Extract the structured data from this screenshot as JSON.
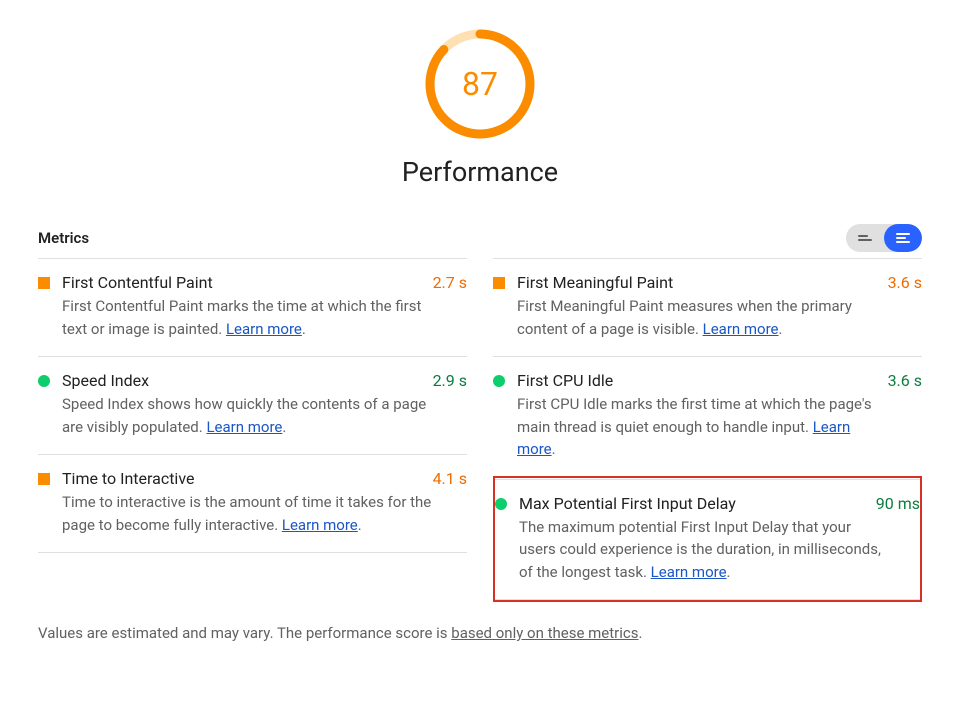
{
  "score": {
    "value": 87,
    "max": 100,
    "color": "#fb8c00"
  },
  "category": "Performance",
  "metrics_heading": "Metrics",
  "learn_more_label": "Learn more",
  "metrics": {
    "left": [
      {
        "marker": "square",
        "title": "First Contentful Paint",
        "value": "2.7 s",
        "value_color": "orange",
        "desc_before": "First Contentful Paint marks the time at which the first text or image is painted. ",
        "desc_after": "."
      },
      {
        "marker": "circle",
        "title": "Speed Index",
        "value": "2.9 s",
        "value_color": "green",
        "desc_before": "Speed Index shows how quickly the contents of a page are visibly populated. ",
        "desc_after": "."
      },
      {
        "marker": "square",
        "title": "Time to Interactive",
        "value": "4.1 s",
        "value_color": "orange",
        "desc_before": "Time to interactive is the amount of time it takes for the page to become fully interactive. ",
        "desc_after": "."
      }
    ],
    "right": [
      {
        "marker": "square",
        "title": "First Meaningful Paint",
        "value": "3.6 s",
        "value_color": "orange",
        "desc_before": "First Meaningful Paint measures when the primary content of a page is visible. ",
        "desc_after": "."
      },
      {
        "marker": "circle",
        "title": "First CPU Idle",
        "value": "3.6 s",
        "value_color": "green",
        "desc_before": "First CPU Idle marks the first time at which the page's main thread is quiet enough to handle input. ",
        "desc_after": "."
      },
      {
        "marker": "circle",
        "title": "Max Potential First Input Delay",
        "value": "90 ms",
        "value_color": "green",
        "highlighted": true,
        "desc_before": "The maximum potential First Input Delay that your users could experience is the duration, in milliseconds, of the longest task. ",
        "desc_after": "."
      }
    ]
  },
  "footnote": {
    "before": "Values are estimated and may vary. The performance score is ",
    "link": "based only on these metrics",
    "after": "."
  }
}
